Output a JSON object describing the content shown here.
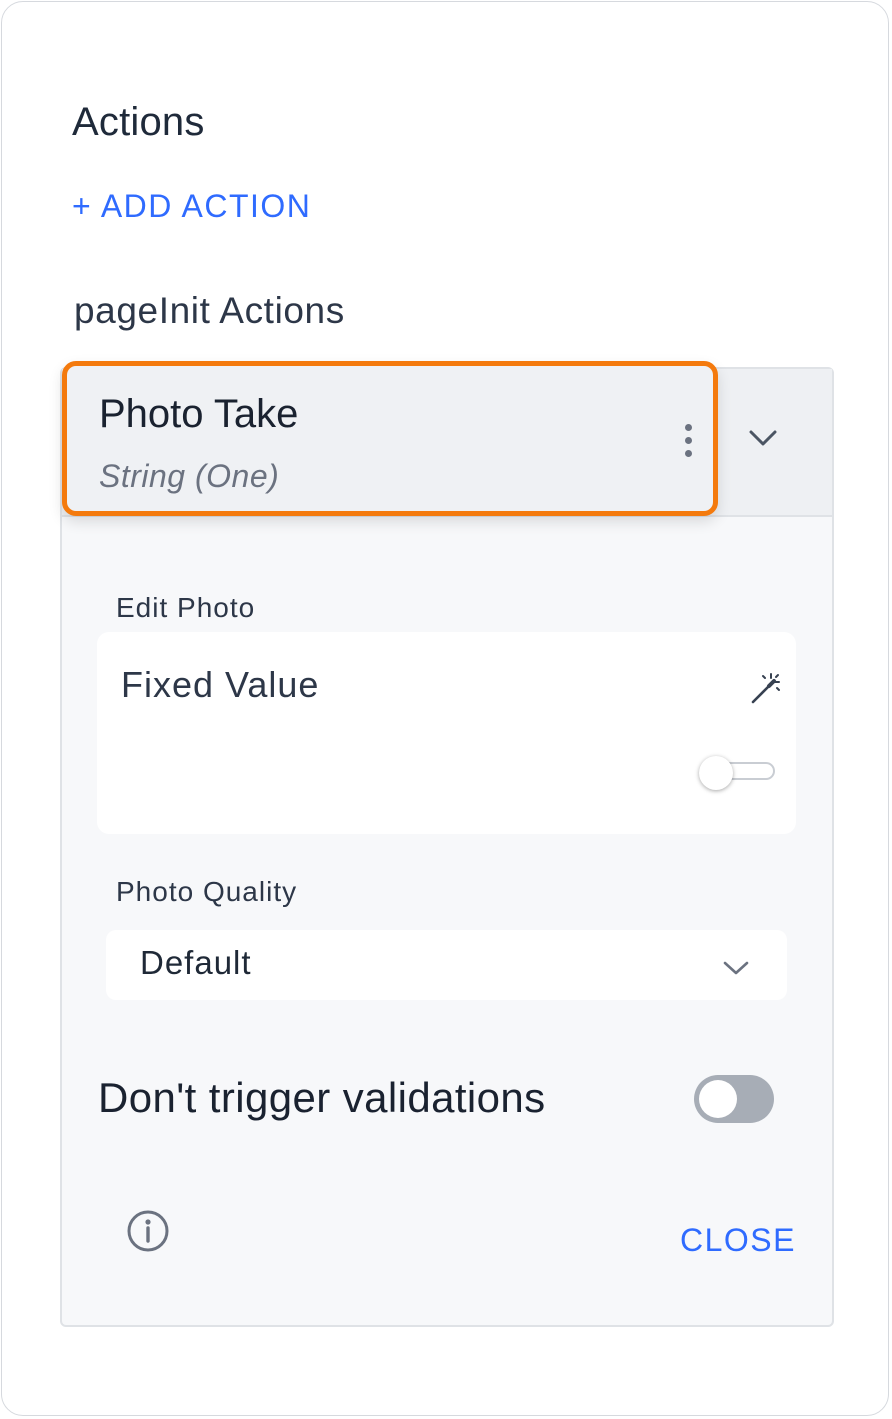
{
  "actions": {
    "heading": "Actions",
    "add_action_label": "+ ADD ACTION",
    "section_label": "pageInit Actions"
  },
  "action_card": {
    "title": "Photo Take",
    "subtitle": "String (One)",
    "menu_icon": "kebab-vertical-icon",
    "expand_icon": "chevron-down-icon"
  },
  "edit_photo": {
    "label": "Edit Photo",
    "mode_label": "Fixed Value",
    "wand_icon": "magic-wand-icon",
    "toggle_on": false
  },
  "photo_quality": {
    "label": "Photo Quality",
    "selected": "Default",
    "dropdown_icon": "chevron-down-icon"
  },
  "validation": {
    "label": "Don't trigger validations",
    "toggle_on": false
  },
  "footer": {
    "info_icon": "info-circle-icon",
    "close_label": "CLOSE"
  },
  "colors": {
    "accent": "#2f6bff",
    "highlight_border": "#f47a0d",
    "toggle_off": "#a7adb6"
  }
}
